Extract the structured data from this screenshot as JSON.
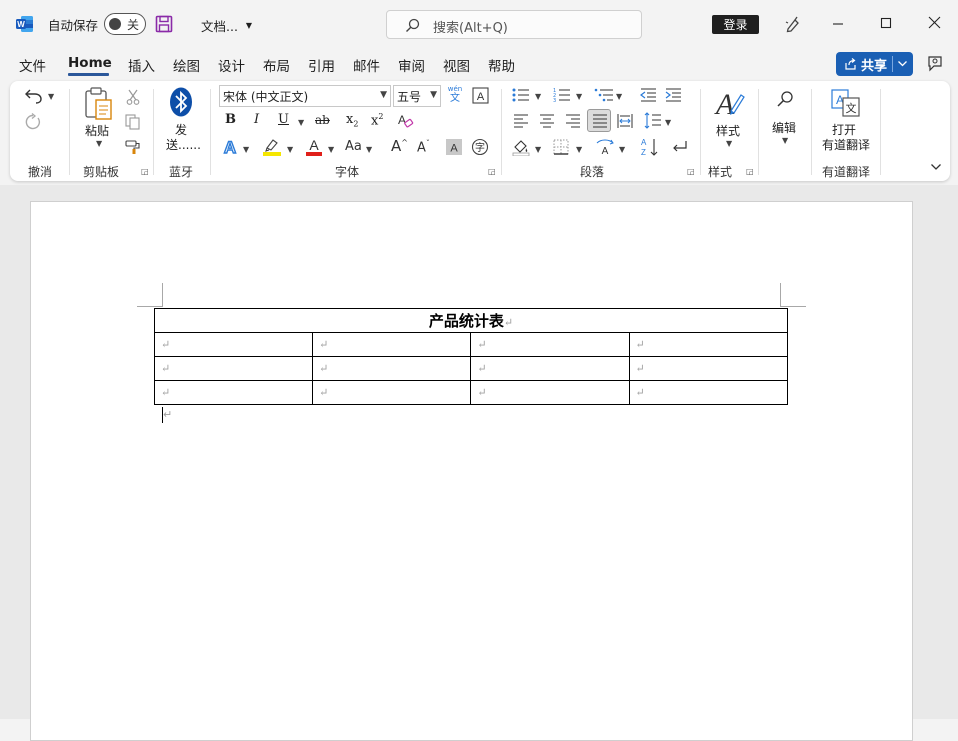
{
  "titlebar": {
    "autosave_label": "自动保存",
    "autosave_state": "关",
    "doc_title": "文档...",
    "search_placeholder": "搜索(Alt+Q)",
    "login_label": "登录"
  },
  "menu": {
    "tabs": [
      "文件",
      "Home",
      "插入",
      "绘图",
      "设计",
      "布局",
      "引用",
      "邮件",
      "审阅",
      "视图",
      "帮助"
    ],
    "active_tab": "Home",
    "share_label": "共享"
  },
  "ribbon": {
    "groups": {
      "undo": "撤消",
      "clipboard": "剪贴板",
      "bluetooth": "蓝牙",
      "font": "字体",
      "paragraph": "段落",
      "styles": "样式",
      "translate": "有道翻译"
    },
    "paste_label": "粘贴",
    "send_label_1": "发",
    "send_label_2": "送......",
    "font_name": "宋体 (中文正文)",
    "font_size": "五号",
    "wen_label": "wén",
    "wen_char": "文",
    "styles_label": "样式",
    "edit_label": "编辑",
    "translate_label_1": "打开",
    "translate_label_2": "有道翻译",
    "bold": "B",
    "italic": "I",
    "underline": "U",
    "strike": "ab",
    "subscript": "x",
    "subscript_mark": "2",
    "superscript": "x",
    "superscript_mark": "2",
    "change_case": "Aa",
    "grow_font": "A",
    "shrink_font": "A",
    "highlight_color": "#f5e600",
    "font_color": "#e0201a",
    "text_effect_color": "#2b7bd8"
  },
  "document": {
    "table_title": "产品统计表",
    "paragraph_mark": "↵",
    "rows": 3,
    "cols": 4
  }
}
